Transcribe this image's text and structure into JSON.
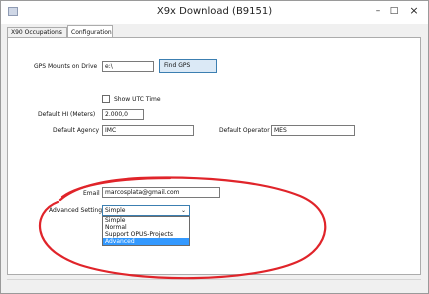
{
  "window": {
    "title": "X9x Download  (B9151)",
    "controls": {
      "minimize": "–",
      "maximize": "□",
      "close": "×"
    }
  },
  "tabs": [
    {
      "label": "X90 Occupations",
      "active": false
    },
    {
      "label": "Configuration",
      "active": true
    }
  ],
  "config": {
    "gps_mounts_label": "GPS Mounts on Drive",
    "gps_mounts_value": "e:\\",
    "find_gps_button": "Find GPS",
    "show_utc_label": "Show UTC Time",
    "show_utc_checked": false,
    "default_hi_label": "Default HI (Meters)",
    "default_hi_value": "2.000,0",
    "default_agency_label": "Default Agency",
    "default_agency_value": "IMC",
    "default_operator_label": "Default Operator",
    "default_operator_value": "MES",
    "email_label": "Email",
    "email_value": "marcosplata@gmail.com",
    "advanced_settings_label": "Advanced Settings",
    "advanced_settings_selected": "Simple",
    "advanced_settings_options": [
      "Simple",
      "Normal",
      "Support OPUS-Projects",
      "Advanced"
    ],
    "advanced_settings_highlighted": "Advanced"
  },
  "colors": {
    "annotation": "#e0242a",
    "highlight": "#3399ff",
    "focus_border": "#3c7fb1"
  }
}
